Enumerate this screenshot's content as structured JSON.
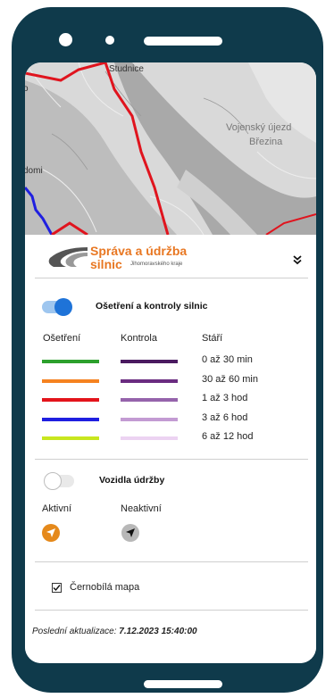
{
  "map": {
    "place_labels": [
      "Studnice",
      "Vojenský újezd",
      "Březina",
      "domi",
      "o"
    ],
    "road_color": "#e0141e"
  },
  "logo": {
    "line1": "Správa a údržba",
    "line2": "silnic",
    "sub": "Jihomoravského kraje",
    "brand_color": "#e87722",
    "expand_icon": "double-chevron-down-icon"
  },
  "treatment": {
    "toggle_on": true,
    "title": "Ošetření a kontroly silnic",
    "col_treatment": "Ošetření",
    "col_control": "Kontrola",
    "col_age": "Stáří",
    "rows": [
      {
        "age": "0 až 30 min",
        "treatment_color": "#2ca02c",
        "control_color": "#4a1a60"
      },
      {
        "age": "30 až 60 min",
        "treatment_color": "#f58220",
        "control_color": "#6a2c80"
      },
      {
        "age": "1 až 3 hod",
        "treatment_color": "#e3141b",
        "control_color": "#9563ab"
      },
      {
        "age": "3 až 6 hod",
        "treatment_color": "#1f1fe0",
        "control_color": "#c39bd3"
      },
      {
        "age": "6 až 12 hod",
        "treatment_color": "#c8e61e",
        "control_color": "#ecd3f2"
      }
    ]
  },
  "vehicles": {
    "toggle_on": false,
    "title": "Vozidla údržby",
    "active_label": "Aktivní",
    "inactive_label": "Neaktivní",
    "active_color": "#e5891b",
    "inactive_color": "#b8b8b8"
  },
  "bw_map": {
    "checked": true,
    "label": "Černobílá mapa"
  },
  "update": {
    "prefix": "Poslední aktualizace:",
    "value": "7.12.2023 15:40:00"
  }
}
